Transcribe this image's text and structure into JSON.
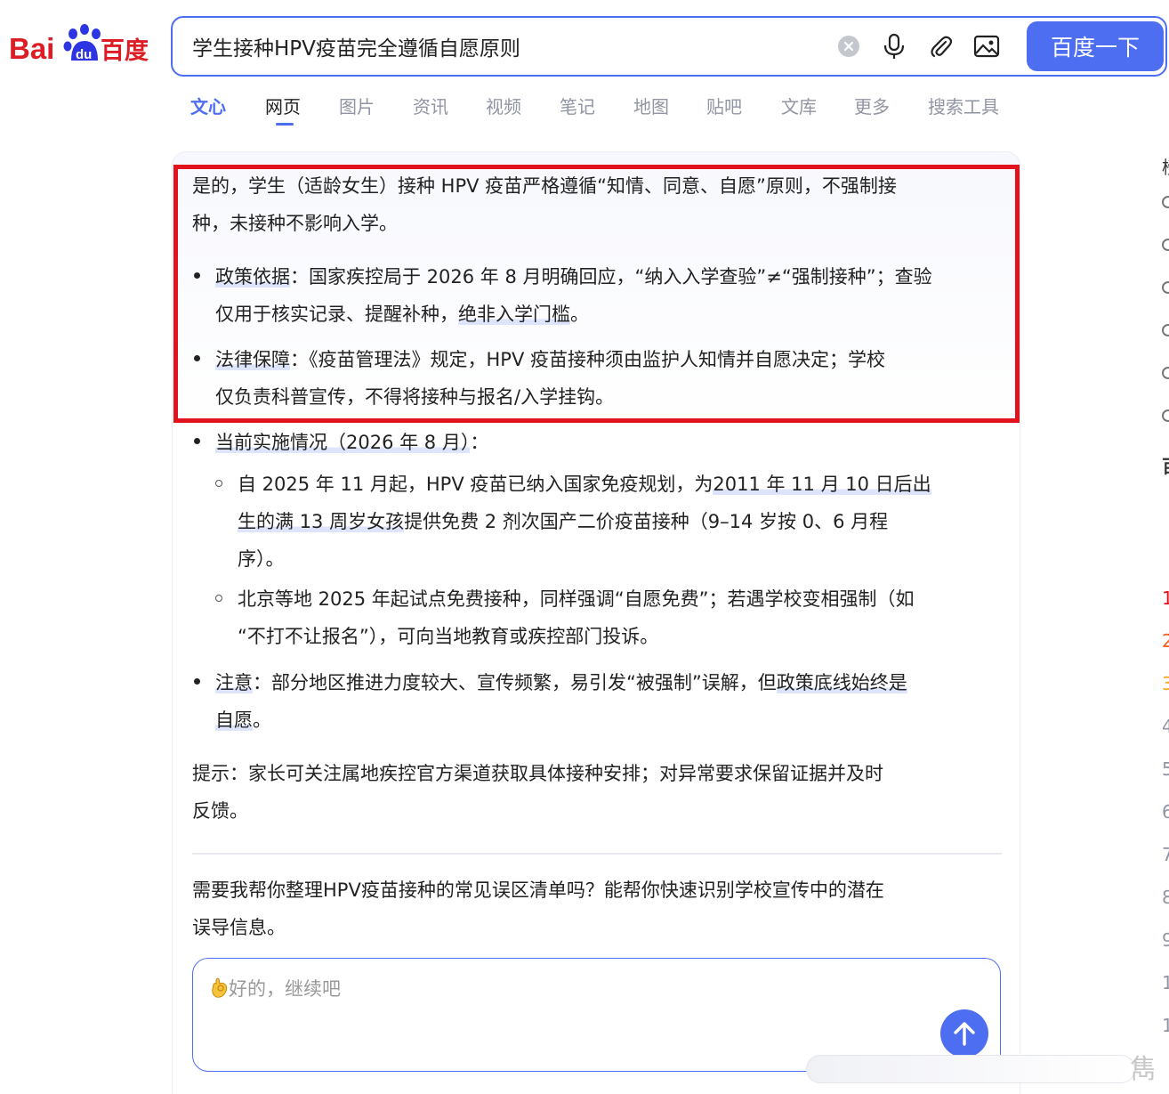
{
  "logo": {
    "text_left": "Bai",
    "text_mid": "du",
    "text_right": "百度"
  },
  "search": {
    "query": "学生接种HPV疫苗完全遵循自愿原则",
    "button_label": "百度一下"
  },
  "tabs": [
    "文心",
    "网页",
    "图片",
    "资讯",
    "视频",
    "笔记",
    "地图",
    "贴吧",
    "文库",
    "更多",
    "搜索工具"
  ],
  "answer": {
    "intro_line1": "是的，学生（适龄女生）接种 HPV 疫苗严格遵循“知情、同意、自愿”原则，不强制接",
    "intro_line2": "种，未接种不影响入学。",
    "b1_label": "政策依据",
    "b1_line1": "：国家疾控局于 2026 年 8 月明确回应，“纳入入学查验”≠“强制接种”；查验",
    "b1_line2_a": "仅用于核实记录、提醒补种，",
    "b1_line2_b": "绝非入学门槛",
    "b1_line2_c": "。",
    "b2_label": "法律保障",
    "b2_line1": "：《疫苗管理法》规定，HPV 疫苗接种须由监护人知情并自愿决定；学校",
    "b2_line2": "仅负责科普宣传，不得将接种与报名/入学挂钩。",
    "b3_label": "当前实施情况（2026 年 8 月）",
    "b3_colon": "：",
    "s1_line1_a": "自 2025 年 11 月起，HPV 疫苗已纳入国家免疫规划，为",
    "s1_line1_b": "2011 年 11 月 10 日后出",
    "s1_line2_a": "生的满 13 周岁女孩",
    "s1_line2_b": "提供免费 2 剂次国产二价疫苗接种（9–14 岁按 0、6 月程",
    "s1_line3": "序）。",
    "s2_line1": "北京等地 2025 年起试点免费接种，同样强调“自愿免费”；若遇学校变相强制（如",
    "s2_line2": "“不打不让报名”），可向当地教育或疾控部门投诉。",
    "b4_label": "注意",
    "b4_line1_a": "：部分地区推进力度较大、宣传频繁，易引发“被强制”误解，但",
    "b4_line1_b": "政策底线始终是",
    "b4_line2": "自愿",
    "b4_line2_end": "。",
    "tip_line1": "提示：家长可关注属地疾控官方渠道获取具体接种安排；对异常要求保留证据并及时",
    "tip_line2": "反馈。",
    "followup_line1": "需要我帮你整理HPV疫苗接种的常见误区清单吗？能帮你快速识别学校宣传中的潜在",
    "followup_line2": "误导信息。",
    "input_placeholder": "好的，继续吧"
  },
  "right_edge_numbers": [
    "1",
    "2",
    "3",
    "4",
    "5",
    "6",
    "7",
    "8",
    "9",
    "1",
    "1"
  ],
  "watermark": "雋",
  "colors": {
    "brand_blue": "#4e6ef2",
    "frame_red": "#e1141e",
    "baidu_red": "#de1c24",
    "baidu_blue": "#2d35e3"
  }
}
